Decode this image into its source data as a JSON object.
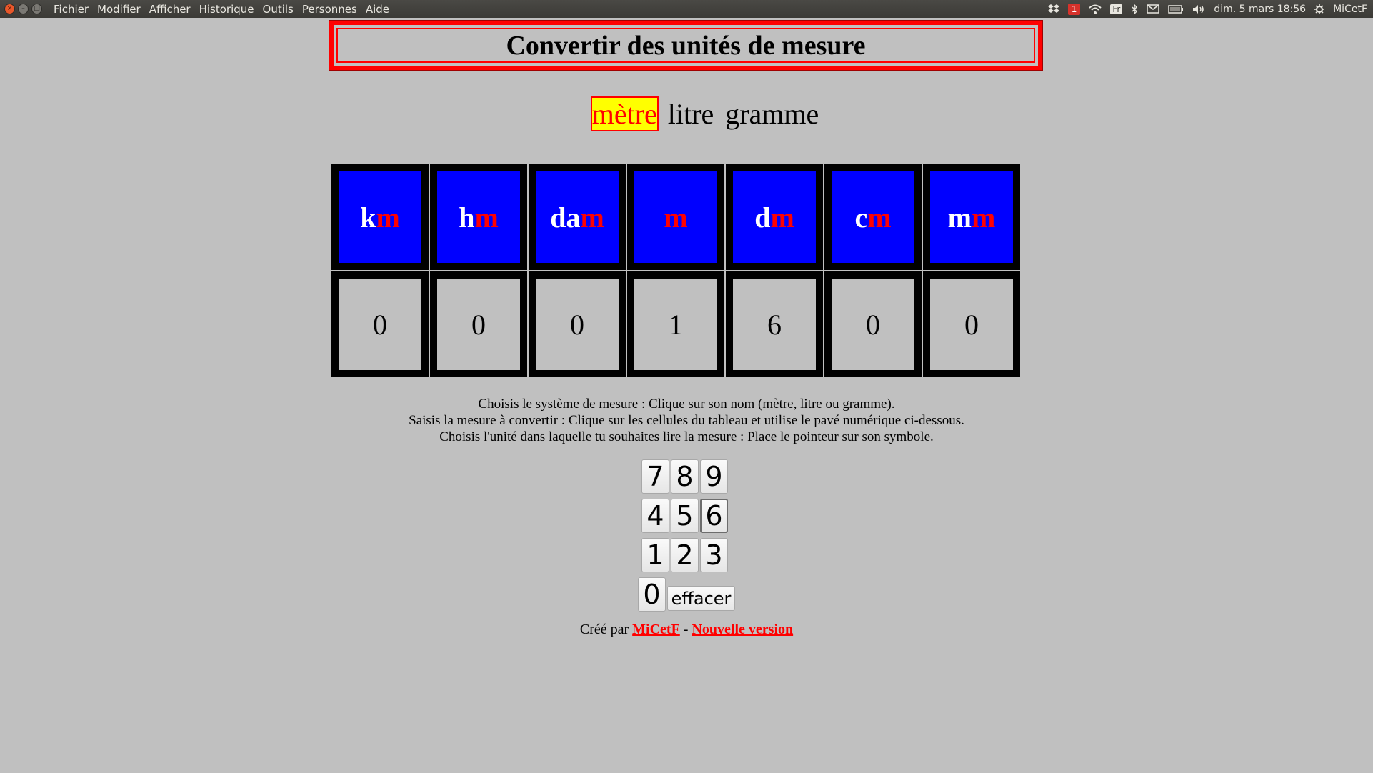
{
  "topbar": {
    "menu": [
      "Fichier",
      "Modifier",
      "Afficher",
      "Historique",
      "Outils",
      "Personnes",
      "Aide"
    ],
    "notification_count": "1",
    "keyboard_layout": "Fr",
    "datetime": "dim. 5 mars 18:56",
    "user": "MiCetF"
  },
  "title": "Convertir des unités de mesure",
  "systems": {
    "active": "mètre",
    "items": [
      "mètre",
      "litre",
      "gramme"
    ]
  },
  "units": [
    {
      "prefix": "k",
      "base": "m",
      "digit": "0"
    },
    {
      "prefix": "h",
      "base": "m",
      "digit": "0"
    },
    {
      "prefix": "da",
      "base": "m",
      "digit": "0"
    },
    {
      "prefix": "",
      "base": "m",
      "digit": "1"
    },
    {
      "prefix": "d",
      "base": "m",
      "digit": "6"
    },
    {
      "prefix": "c",
      "base": "m",
      "digit": "0"
    },
    {
      "prefix": "m",
      "base": "m",
      "digit": "0"
    }
  ],
  "colors": {
    "unit_bg": "#0000ff",
    "unit_base": "#ff0000",
    "active_system_bg": "#ffff00",
    "title_border": "#ff0000"
  },
  "instructions": [
    "Choisis le système de mesure : Clique sur son nom (mètre, litre ou gramme).",
    "Saisis la mesure à convertir : Clique sur les cellules du tableau et utilise le pavé numérique ci-dessous.",
    "Choisis l'unité dans laquelle tu souhaites lire la mesure : Place le pointeur sur son symbole."
  ],
  "keypad": {
    "rows": [
      [
        "7",
        "8",
        "9"
      ],
      [
        "4",
        "5",
        "6"
      ],
      [
        "1",
        "2",
        "3"
      ]
    ],
    "zero": "0",
    "erase": "effacer",
    "focused_key": "6"
  },
  "footer": {
    "prefix": "Créé par",
    "author": "MiCetF",
    "separator": "-",
    "new_version": "Nouvelle version"
  }
}
